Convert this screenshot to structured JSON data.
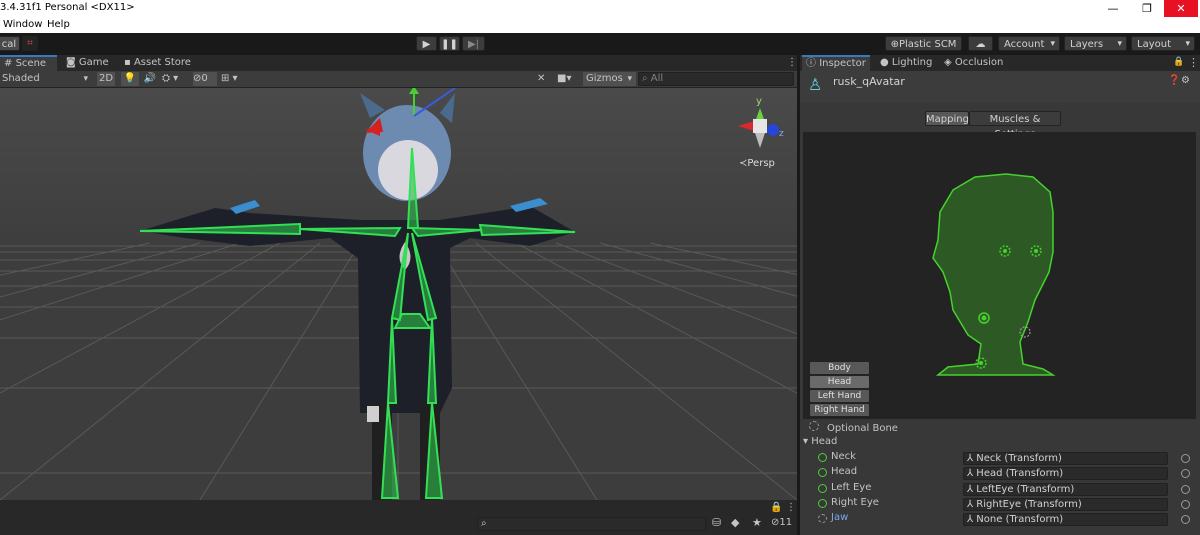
{
  "window": {
    "title": "3.4.31f1 Personal <DX11>",
    "controls": [
      "—",
      "❐",
      "✕"
    ]
  },
  "menu": {
    "items": [
      "Window",
      "Help"
    ]
  },
  "toolbar": {
    "layer_label": "cal",
    "play_icons": [
      "▶",
      "❚❚",
      "▶|"
    ],
    "plastic_scm": "Plastic SCM",
    "account": "Account",
    "layers": "Layers",
    "layout": "Layout"
  },
  "scene": {
    "tabs": [
      "Scene",
      "Game",
      "Asset Store"
    ],
    "shading_mode": "Shaded",
    "mode_2d": "2D",
    "hidden_count": "0",
    "gizmos": "Gizmos",
    "search_placeholder": "All",
    "persp_label": "≺Persp",
    "gizmo_axes": {
      "y": "y",
      "z": "z"
    }
  },
  "bottom": {
    "layer_count": "11"
  },
  "inspector": {
    "tabs": [
      "Inspector",
      "Lighting",
      "Occlusion"
    ],
    "object_name": "rusk_qAvatar",
    "subtabs": [
      "Mapping",
      "Muscles & Settings"
    ],
    "body_parts": [
      "Body",
      "Head",
      "Left Hand",
      "Right Hand"
    ],
    "selected_part": "Head",
    "optional_bone": "Optional Bone",
    "section": "Head",
    "bones": [
      {
        "name": "Neck",
        "target": "Neck (Transform)",
        "optional": false
      },
      {
        "name": "Head",
        "target": "Head (Transform)",
        "optional": false
      },
      {
        "name": "Left Eye",
        "target": "LeftEye (Transform)",
        "optional": false
      },
      {
        "name": "Right Eye",
        "target": "RightEye (Transform)",
        "optional": false
      },
      {
        "name": "Jaw",
        "target": "None (Transform)",
        "optional": true
      }
    ],
    "colors": {
      "bone_green": "#46d22d",
      "head_fill": "#2d5a24",
      "jaw_blue": "#7aa7e8"
    }
  }
}
